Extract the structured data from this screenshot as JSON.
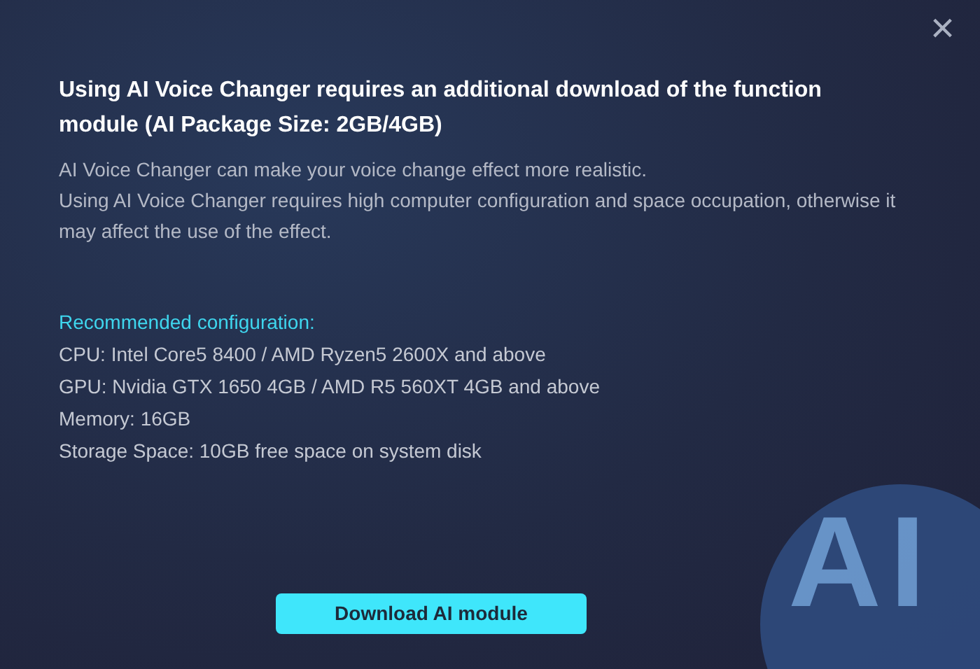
{
  "dialog": {
    "close_symbol": "×",
    "heading": "Using AI Voice Changer requires an additional download of the function module (AI Package Size: 2GB/4GB)",
    "description": [
      "AI Voice Changer can make your voice change effect more realistic.",
      "Using AI Voice Changer requires high computer configuration and space occupation, otherwise it may affect the use of the effect."
    ],
    "config_title": "Recommended configuration:",
    "config_items": [
      "CPU: Intel Core5 8400 / AMD Ryzen5 2600X and above",
      "GPU: Nvidia GTX 1650 4GB / AMD R5 560XT 4GB and above",
      "Memory: 16GB",
      "Storage Space: 10GB free space on system disk"
    ],
    "badge_text": "AI",
    "button": "Download AI module"
  }
}
